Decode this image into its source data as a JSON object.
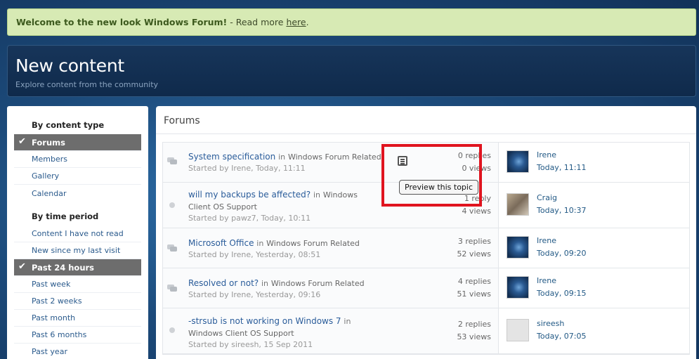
{
  "announcement": {
    "bold": "Welcome to the new look Windows Forum!",
    "text": " - Read more ",
    "link": "here",
    "tail": "."
  },
  "header": {
    "title": "New content",
    "subtitle": "Explore content from the community"
  },
  "sidebar": {
    "section1": "By content type",
    "content_types": [
      "Forums",
      "Members",
      "Gallery",
      "Calendar"
    ],
    "section2": "By time period",
    "time_periods": [
      "Content I have not read",
      "New since my last visit",
      "Past 24 hours",
      "Past week",
      "Past 2 weeks",
      "Past month",
      "Past 6 months",
      "Past year"
    ]
  },
  "main": {
    "title": "Forums",
    "in_word": "in",
    "topics": [
      {
        "title": "System specification",
        "forum": "Windows Forum Related",
        "meta": "Started by Irene, Today, 11:11",
        "replies": "0 replies",
        "views": "0 views",
        "last_user": "Irene",
        "last_time": "Today, 11:11"
      },
      {
        "title": "will my backups be affected?",
        "forum": "Windows Client OS Support",
        "meta": "Started by pawz7, Today, 10:11",
        "replies": "1 reply",
        "views": "4 views",
        "last_user": "Craig",
        "last_time": "Today, 10:37"
      },
      {
        "title": "Microsoft Office",
        "forum": "Windows Forum Related",
        "meta": "Started by Irene, Yesterday, 08:51",
        "replies": "3 replies",
        "views": "52 views",
        "last_user": "Irene",
        "last_time": "Today, 09:20"
      },
      {
        "title": "Resolved or not?",
        "forum": "Windows Forum Related",
        "meta": "Started by Irene, Yesterday, 09:16",
        "replies": "4 replies",
        "views": "51 views",
        "last_user": "Irene",
        "last_time": "Today, 09:15"
      },
      {
        "title": "-strsub is not working on Windows 7",
        "forum": "Windows Client OS Support",
        "meta": "Started by sireesh, 15 Sep 2011",
        "replies": "2 replies",
        "views": "53 views",
        "last_user": "sireesh",
        "last_time": "Today, 07:05"
      }
    ]
  },
  "tooltip": "Preview this topic",
  "colors": {
    "highlight_box": "#e0141f",
    "active_item": "#6d6d6d",
    "link": "#2a5c9a"
  }
}
